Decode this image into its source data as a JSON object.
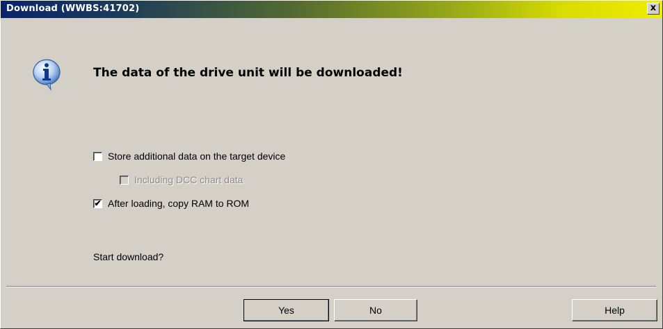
{
  "window": {
    "title": "Download (WWBS:41702)",
    "close_glyph": "x"
  },
  "message": {
    "icon": "info-icon",
    "text": "The data of the drive unit will be downloaded!"
  },
  "options": [
    {
      "label": "Store additional data on the target device",
      "checked": false,
      "enabled": true,
      "mark": ""
    },
    {
      "label": "Including DCC chart data",
      "checked": false,
      "enabled": false,
      "mark": ""
    },
    {
      "label": "After loading, copy RAM to ROM",
      "checked": true,
      "enabled": true,
      "mark": "✔"
    }
  ],
  "prompt": "Start download?",
  "buttons": {
    "yes": "Yes",
    "no": "No",
    "help": "Help"
  }
}
